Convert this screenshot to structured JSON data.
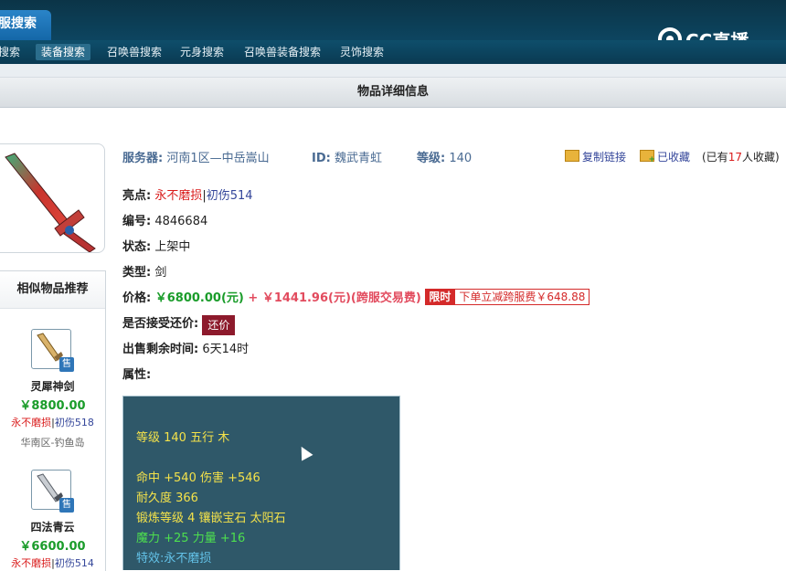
{
  "top": {
    "tab_label": "服搜索",
    "logo_text": "CC直播"
  },
  "nav": {
    "items": [
      "搜索",
      "装备搜索",
      "召唤兽搜索",
      "元身搜索",
      "召唤兽装备搜索",
      "灵饰搜索"
    ],
    "active_index": 1
  },
  "page_title": "物品详细信息",
  "header": {
    "server_label": "服务器:",
    "server_value": "河南1区—中岳嵩山",
    "id_label": "ID:",
    "id_value": "魏武青虹",
    "level_label": "等级:",
    "level_value": "140",
    "copy_link": "复制链接",
    "collected": "已收藏",
    "collect_count_prefix": "(已有",
    "collect_count": "17",
    "collect_count_suffix": "人收藏)"
  },
  "details": {
    "highlight_label": "亮点:",
    "highlight_tag1": "永不磨损",
    "highlight_sep": "|",
    "highlight_tag2": "初伤514",
    "number_label": "编号:",
    "number_value": "4846684",
    "status_label": "状态:",
    "status_value": "上架中",
    "type_label": "类型:",
    "type_value": "剑",
    "price_label": "价格:",
    "price_value": "￥6800.00(元)",
    "price_plus": "+",
    "cross_fee": "￥1441.96(元)(跨服交易费)",
    "limited_badge": "限时",
    "discount_text": "下单立减跨服费￥648.88",
    "counter_label": "是否接受还价:",
    "counter_button": "还价",
    "remaining_label": "出售剩余时间:",
    "remaining_value": "6天14时",
    "attr_label": "属性:"
  },
  "stats": {
    "line1": "等级 140 五行 木",
    "line2": "命中 +540 伤害 +546",
    "line3": "耐久度 366",
    "line4": "锻炼等级 4 镶嵌宝石 太阳石",
    "line5": "魔力 +25 力量 +16",
    "line6": "特效:永不磨损"
  },
  "sidebar": {
    "title": "相似物品推荐",
    "sold_label": "售",
    "items": [
      {
        "name": "灵犀神剑",
        "price": "￥8800.00",
        "tag1": "永不磨损",
        "sep": "|",
        "tag2": "初伤518",
        "server": "华南区-钓鱼岛"
      },
      {
        "name": "四法青云",
        "price": "￥6600.00",
        "tag1": "永不磨损",
        "sep": "|",
        "tag2": "初伤514"
      }
    ]
  },
  "colors": {
    "nav_bg": "#0a3a52",
    "price_green": "#1a9c2a",
    "accent_red": "#d42a2a",
    "stat_bg": "#2f5869"
  }
}
